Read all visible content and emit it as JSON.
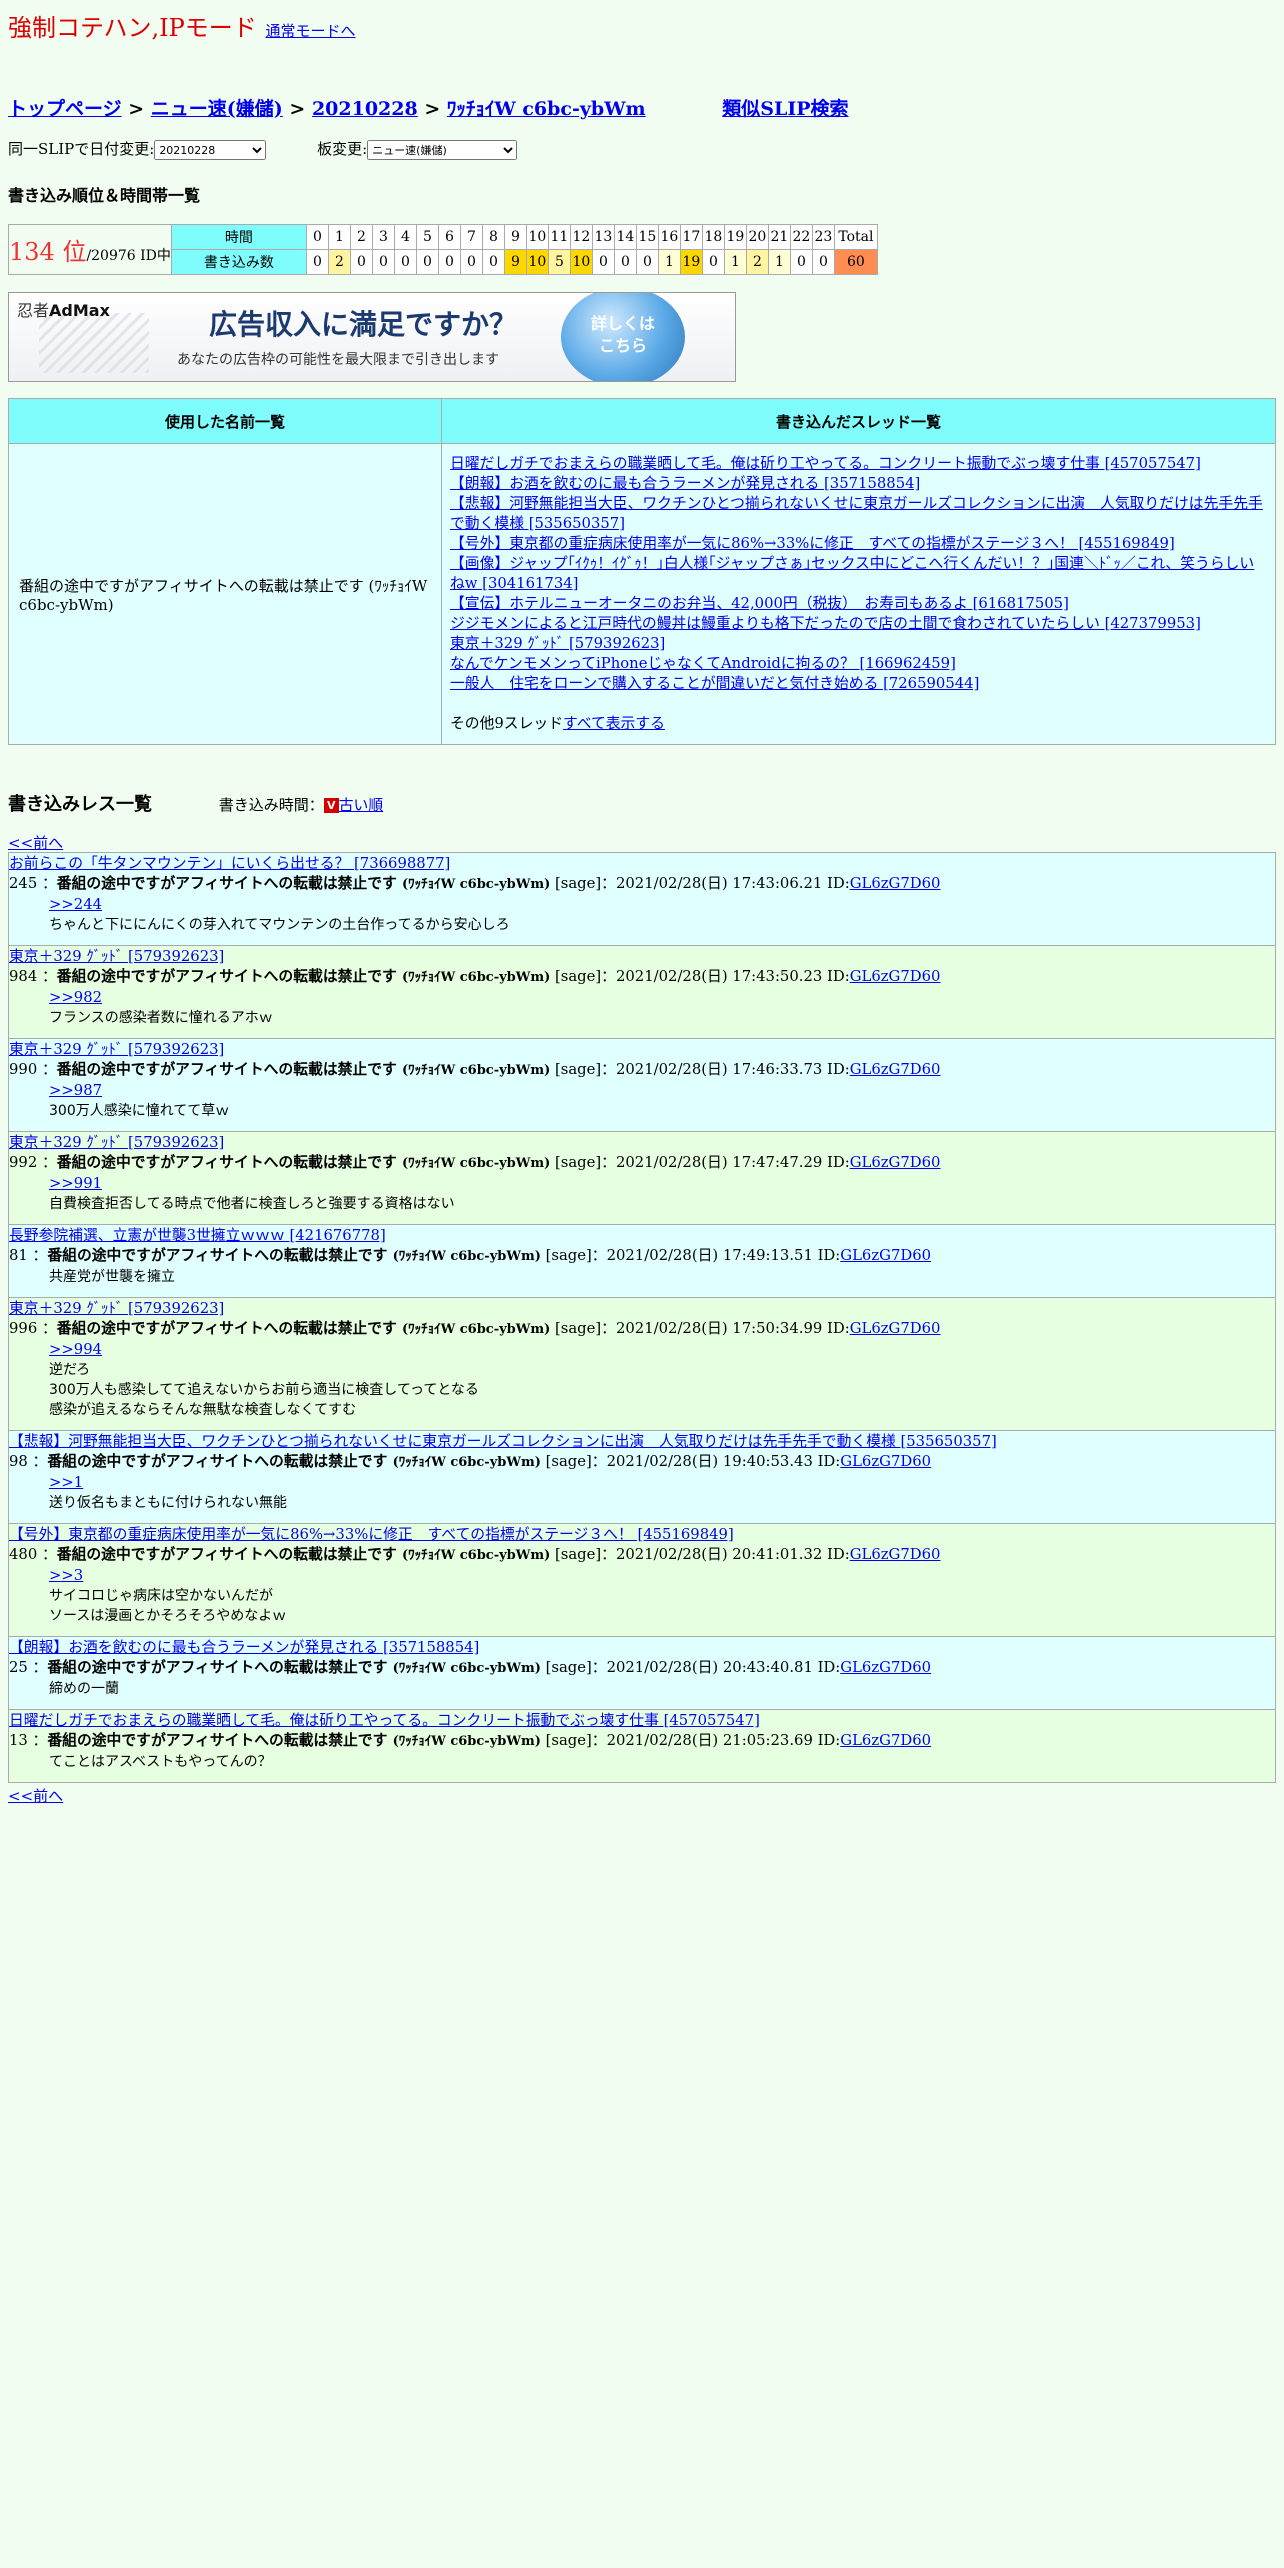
{
  "header": {
    "title": "強制コテハン,IPモード",
    "mode_link": "通常モードへ"
  },
  "breadcrumb": {
    "top": "トップページ",
    "sep": ">",
    "board": "ニュー速(嫌儲)",
    "date": "20210228",
    "slip": "ﾜｯﾁｮｲW c6bc-ybWm",
    "similar": "類似SLIP検索"
  },
  "change": {
    "date_label": "同一SLIPで日付変更:",
    "date_value": "20210228",
    "board_label": "板変更:",
    "board_value": "ニュー速(嫌儲)"
  },
  "rank": {
    "heading": "書き込み順位＆時間帯一覧",
    "place": "134 位",
    "total": "/20976 ID中",
    "time_label": "時間",
    "count_label": "書き込み数",
    "total_label": "Total",
    "total_value": "60",
    "hours": [
      "0",
      "1",
      "2",
      "3",
      "4",
      "5",
      "6",
      "7",
      "8",
      "9",
      "10",
      "11",
      "12",
      "13",
      "14",
      "15",
      "16",
      "17",
      "18",
      "19",
      "20",
      "21",
      "22",
      "23"
    ],
    "counts": [
      "0",
      "2",
      "0",
      "0",
      "0",
      "0",
      "0",
      "0",
      "0",
      "9",
      "10",
      "5",
      "10",
      "0",
      "0",
      "0",
      "1",
      "19",
      "0",
      "1",
      "2",
      "1",
      "0",
      "0"
    ]
  },
  "ad": {
    "logo_a": "忍者",
    "logo_b": "AdMax",
    "headline": "広告収入に満足ですか？",
    "sub": "あなたの広告枠の可能性を最大限まで引き出します",
    "cta1": "詳しくは",
    "cta2": "こちら"
  },
  "names_table": {
    "col1": "使用した名前一覧",
    "col2": "書き込んだスレッド一覧",
    "name": "番組の途中ですがアフィサイトへの転載は禁止です (ﾜｯﾁｮｲW c6bc-ybWm)",
    "threads": [
      "日曜だしガチでおまえらの職業晒して毛。俺は斫り工やってる。コンクリート振動でぶっ壊す仕事 [457057547]",
      "【朗報】お酒を飲むのに最も合うラーメンが発見される [357158854]",
      "【悲報】河野無能担当大臣、ワクチンひとつ揃られないくせに東京ガールズコレクションに出演　人気取りだけは先手先手で動く模様 [535650357]",
      "【号外】東京都の重症病床使用率が一気に86%→33%に修正　すべての指標がステージ３へ！ [455169849]",
      "【画像】ジャップ｢ｲｸｩ！ｲｸﾞｩ！｣白人様｢ジャップさぁ｣セックス中にどこへ行くんだい！？｣国連＼ﾄﾞｯ／これ、笑うらしいねw [304161734]",
      "【宣伝】ホテルニューオータニのお弁当、42,000円（税抜）　お寿司もあるよ [616817505]",
      "ジジモメンによると江戸時代の鰻丼は鰻重よりも格下だったので店の土間で食わされていたらしい [427379953]",
      "東京＋329 ｸﾞｯﾄﾞ [579392623]",
      "なんでケンモメンってiPhoneじゃなくてAndroidに拘るの？ [166962459]",
      "一般人　住宅をローンで購入することが間違いだと気付き始める [726590544]"
    ],
    "other_prefix": "その他9スレッド",
    "other_link": "すべて表示する"
  },
  "reslist": {
    "title": "書き込みレス一覧",
    "when_label": "書き込み時間：",
    "order_icon": "V",
    "order_link": "古い順",
    "prev": "<<前へ"
  },
  "posts": [
    {
      "thread": "お前らこの「牛タンマウンテン」にいくら出せる？ [736698877]",
      "num": "245",
      "sage": "[sage]：2021/02/28(日) 17:43:06.21 ID:",
      "id": "GL6zG7D60",
      "anchor": ">>244",
      "body": "ちゃんと下ににんにくの芽入れてマウンテンの土台作ってるから安心しろ"
    },
    {
      "thread": "東京＋329 ｸﾞｯﾄﾞ [579392623]",
      "num": "984",
      "sage": "[sage]：2021/02/28(日) 17:43:50.23 ID:",
      "id": "GL6zG7D60",
      "anchor": ">>982",
      "body": "フランスの感染者数に憧れるアホｗ"
    },
    {
      "thread": "東京＋329 ｸﾞｯﾄﾞ [579392623]",
      "num": "990",
      "sage": "[sage]：2021/02/28(日) 17:46:33.73 ID:",
      "id": "GL6zG7D60",
      "anchor": ">>987",
      "body": "300万人感染に憧れてて草ｗ"
    },
    {
      "thread": "東京＋329 ｸﾞｯﾄﾞ [579392623]",
      "num": "992",
      "sage": "[sage]：2021/02/28(日) 17:47:47.29 ID:",
      "id": "GL6zG7D60",
      "anchor": ">>991",
      "body": "自費検査拒否してる時点で他者に検査しろと強要する資格はない"
    },
    {
      "thread": "長野参院補選、立憲が世襲3世擁立ｗｗｗ [421676778]",
      "num": "81",
      "sage": "[sage]：2021/02/28(日) 17:49:13.51 ID:",
      "id": "GL6zG7D60",
      "anchor": "",
      "body": "共産党が世襲を擁立"
    },
    {
      "thread": "東京＋329 ｸﾞｯﾄﾞ [579392623]",
      "num": "996",
      "sage": "[sage]：2021/02/28(日) 17:50:34.99 ID:",
      "id": "GL6zG7D60",
      "anchor": ">>994",
      "body": "逆だろ\n300万人も感染してて追えないからお前ら適当に検査してってとなる\n感染が追えるならそんな無駄な検査しなくてすむ"
    },
    {
      "thread": "【悲報】河野無能担当大臣、ワクチンひとつ揃られないくせに東京ガールズコレクションに出演　人気取りだけは先手先手で動く模様 [535650357]",
      "num": "98",
      "sage": "[sage]：2021/02/28(日) 19:40:53.43 ID:",
      "id": "GL6zG7D60",
      "anchor": ">>1",
      "body": "送り仮名もまともに付けられない無能"
    },
    {
      "thread": "【号外】東京都の重症病床使用率が一気に86%→33%に修正　すべての指標がステージ３へ！ [455169849]",
      "num": "480",
      "sage": "[sage]：2021/02/28(日) 20:41:01.32 ID:",
      "id": "GL6zG7D60",
      "anchor": ">>3",
      "body": "サイコロじゃ病床は空かないんだが\nソースは漫画とかそろそろやめなよｗ"
    },
    {
      "thread": "【朗報】お酒を飲むのに最も合うラーメンが発見される [357158854]",
      "num": "25",
      "sage": "[sage]：2021/02/28(日) 20:43:40.81 ID:",
      "id": "GL6zG7D60",
      "anchor": "",
      "body": "締めの一蘭"
    },
    {
      "thread": "日曜だしガチでおまえらの職業晒して毛。俺は斫り工やってる。コンクリート振動でぶっ壊す仕事 [457057547]",
      "num": "13",
      "sage": "[sage]：2021/02/28(日) 21:05:23.69 ID:",
      "id": "GL6zG7D60",
      "anchor": "",
      "body": "てことはアスベストもやってんの？"
    }
  ],
  "post_name": "番組の途中ですがアフィサイトへの転載は禁止です",
  "post_slip": "(ﾜｯﾁｮｲW c6bc-ybWm)"
}
